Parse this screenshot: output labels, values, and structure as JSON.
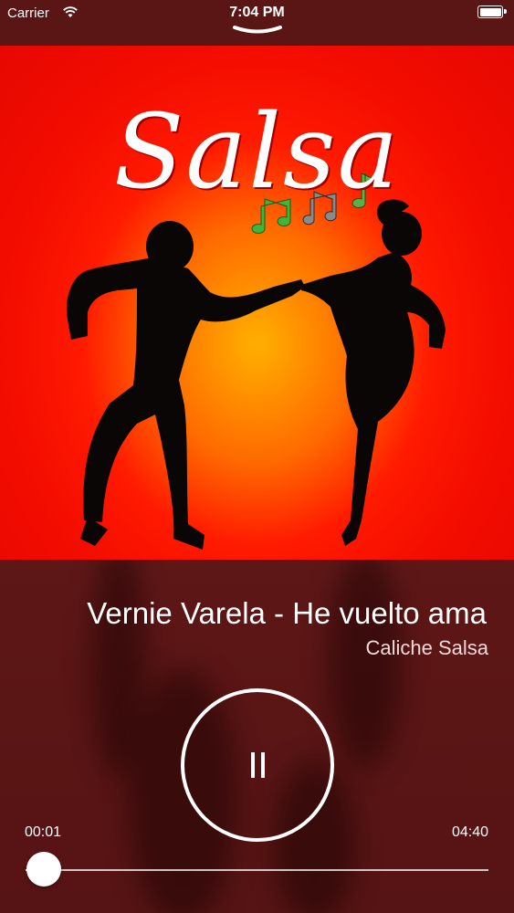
{
  "status_bar": {
    "carrier": "Carrier",
    "time": "7:04 PM",
    "wifi_icon": "wifi-icon",
    "battery_icon": "battery-icon"
  },
  "header": {
    "collapse_icon": "chevron-down-icon"
  },
  "artwork": {
    "title": "Salsa",
    "colors": {
      "background": "#f30c00",
      "glow": "#ffb000"
    }
  },
  "now_playing": {
    "track_title": "Vernie Varela - He vuelto ama",
    "artist": "Caliche Salsa",
    "elapsed": "00:01",
    "duration": "04:40",
    "progress": 0.004,
    "state_icon": "pause-icon"
  },
  "colors": {
    "background": "#5a1515",
    "foreground": "#ffffff"
  }
}
